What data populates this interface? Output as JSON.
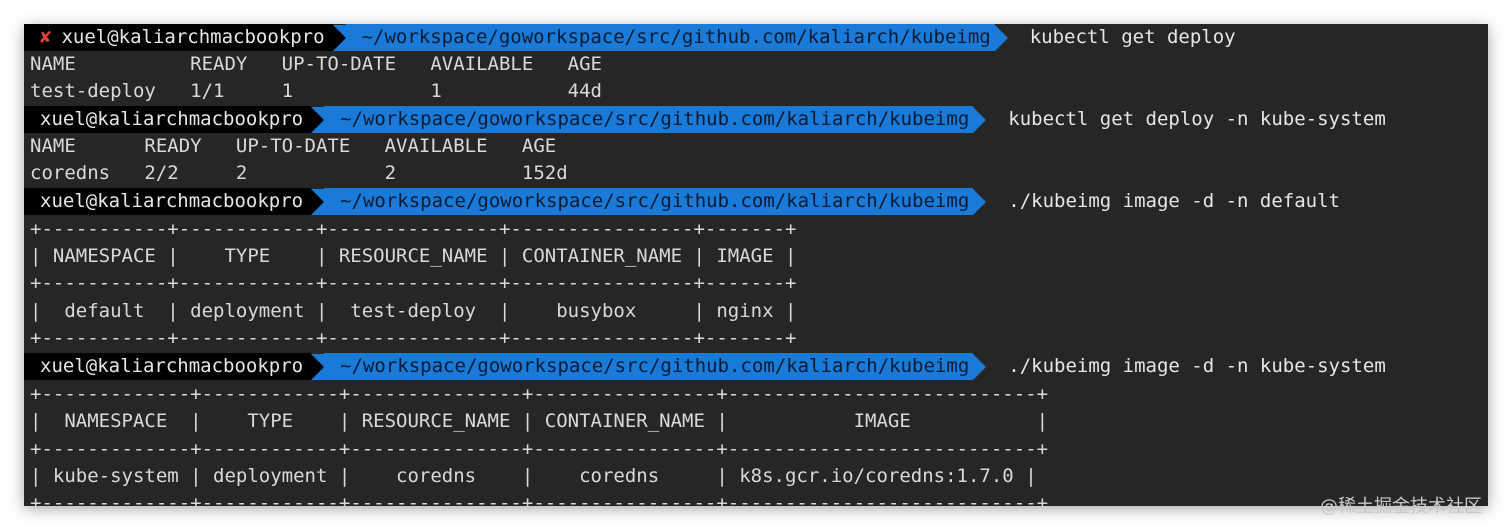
{
  "prompts": [
    {
      "error_mark": "✘",
      "user": "xuel@kaliarchmacbookpro",
      "path": "~/workspace/goworkspace/src/github.com/kaliarch/kubeimg",
      "command": "kubectl get deploy"
    },
    {
      "error_mark": "",
      "user": "xuel@kaliarchmacbookpro",
      "path": "~/workspace/goworkspace/src/github.com/kaliarch/kubeimg",
      "command": "kubectl get deploy -n kube-system"
    },
    {
      "error_mark": "",
      "user": "xuel@kaliarchmacbookpro",
      "path": "~/workspace/goworkspace/src/github.com/kaliarch/kubeimg",
      "command": "./kubeimg image -d -n default"
    },
    {
      "error_mark": "",
      "user": "xuel@kaliarchmacbookpro",
      "path": "~/workspace/goworkspace/src/github.com/kaliarch/kubeimg",
      "command": "./kubeimg image -d -n kube-system"
    }
  ],
  "outputs": {
    "deploy_default": [
      "NAME          READY   UP-TO-DATE   AVAILABLE   AGE",
      "test-deploy   1/1     1            1           44d"
    ],
    "deploy_kube_system": [
      "NAME      READY   UP-TO-DATE   AVAILABLE   AGE",
      "coredns   2/2     2            2           152d"
    ],
    "image_default": [
      "+-----------+------------+---------------+----------------+-------+",
      "| NAMESPACE |    TYPE    | RESOURCE_NAME | CONTAINER_NAME | IMAGE |",
      "+-----------+------------+---------------+----------------+-------+",
      "|  default  | deployment |  test-deploy  |    busybox     | nginx |",
      "+-----------+------------+---------------+----------------+-------+"
    ],
    "image_kube_system": [
      "+-------------+------------+---------------+----------------+---------------------------+",
      "|  NAMESPACE  |    TYPE    | RESOURCE_NAME | CONTAINER_NAME |           IMAGE           |",
      "+-------------+------------+---------------+----------------+---------------------------+",
      "| kube-system | deployment |    coredns    |    coredns     | k8s.gcr.io/coredns:1.7.0 |",
      "+-------------+------------+---------------+----------------+---------------------------+"
    ]
  },
  "watermark": "@稀土掘金技术社区",
  "colors": {
    "background": "#262626",
    "path_segment": "#1a7ad8",
    "user_segment": "#000000",
    "error_mark": "#e0403a"
  }
}
